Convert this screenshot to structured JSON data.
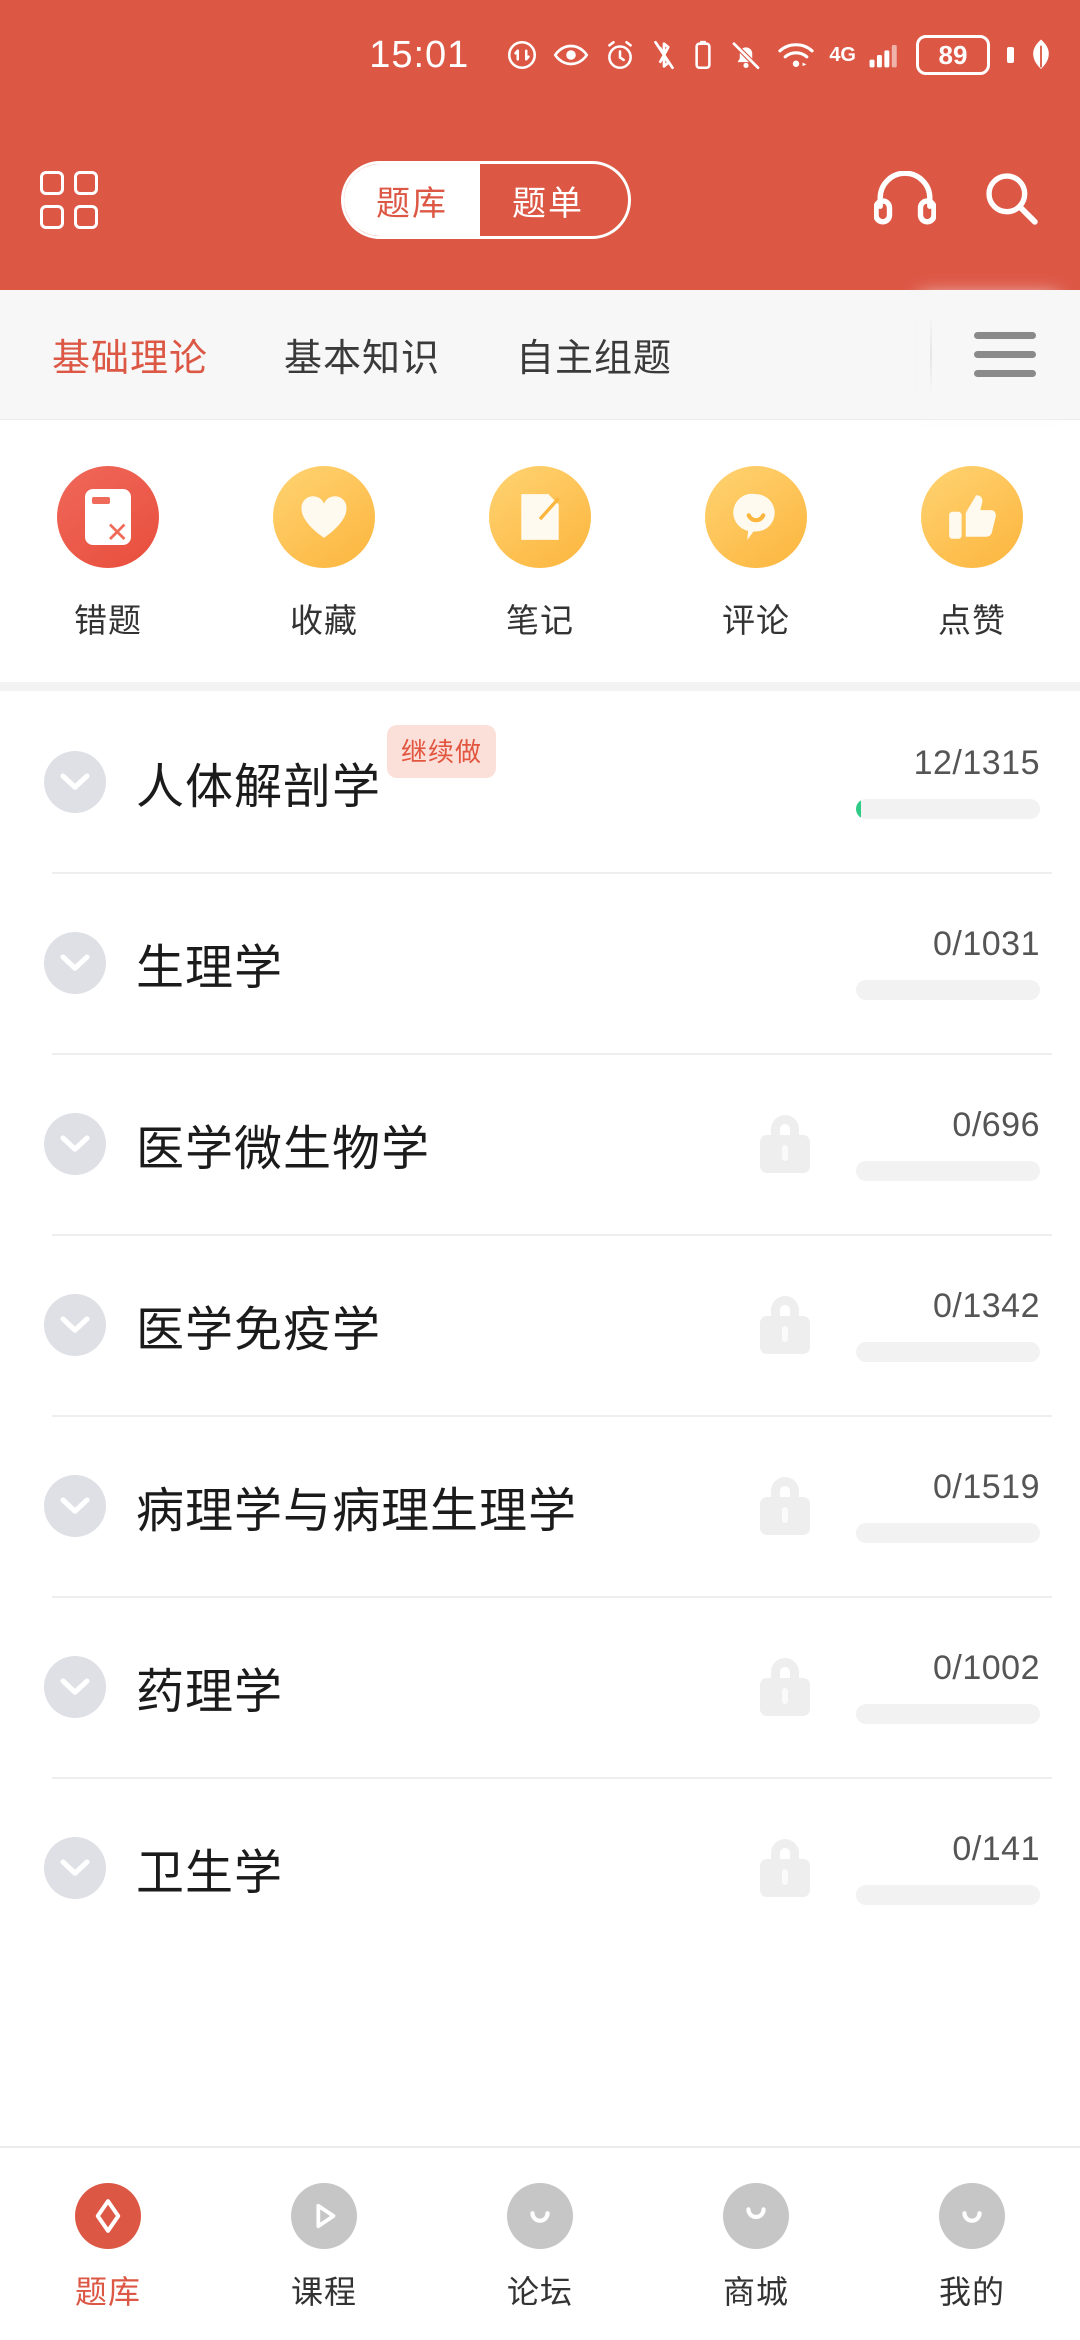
{
  "status_bar": {
    "time": "15:01",
    "battery_level": "89",
    "network": "4G",
    "icons": [
      "data-transfer-icon",
      "eye-care-icon",
      "alarm-clock-icon",
      "bluetooth-off-icon",
      "notification-mute-icon",
      "wifi-icon",
      "signal-icon",
      "battery-icon",
      "leaf-icon"
    ]
  },
  "header": {
    "grid_icon": "grid-menu-icon",
    "segment_left": "题库",
    "segment_right": "题单",
    "headphone_icon": "headphone-icon",
    "search_icon": "search-icon",
    "brand_color": "#dd5745"
  },
  "category_tabs": {
    "items": [
      {
        "label": "基础理论",
        "active": true
      },
      {
        "label": "基本知识",
        "active": false
      },
      {
        "label": "自主组题",
        "active": false
      }
    ],
    "menu_icon": "hamburger-menu-icon"
  },
  "quick_actions": [
    {
      "label": "错题",
      "icon": "wrong-question-card-icon",
      "color": "red"
    },
    {
      "label": "收藏",
      "icon": "heart-icon",
      "color": "yellow"
    },
    {
      "label": "笔记",
      "icon": "note-pencil-icon",
      "color": "yellow"
    },
    {
      "label": "评论",
      "icon": "comment-bubble-icon",
      "color": "yellow"
    },
    {
      "label": "点赞",
      "icon": "thumbs-up-icon",
      "color": "yellow"
    }
  ],
  "subjects": [
    {
      "title": "人体解剖学",
      "badge": "继续做",
      "locked": false,
      "done": 12,
      "total": 1315,
      "count_label": "12/1315",
      "percent": 0.9
    },
    {
      "title": "生理学",
      "badge": "",
      "locked": false,
      "done": 0,
      "total": 1031,
      "count_label": "0/1031",
      "percent": 0
    },
    {
      "title": "医学微生物学",
      "badge": "",
      "locked": true,
      "done": 0,
      "total": 696,
      "count_label": "0/696",
      "percent": 0
    },
    {
      "title": "医学免疫学",
      "badge": "",
      "locked": true,
      "done": 0,
      "total": 1342,
      "count_label": "0/1342",
      "percent": 0
    },
    {
      "title": "病理学与病理生理学",
      "badge": "",
      "locked": true,
      "done": 0,
      "total": 1519,
      "count_label": "0/1519",
      "percent": 0
    },
    {
      "title": "药理学",
      "badge": "",
      "locked": true,
      "done": 0,
      "total": 1002,
      "count_label": "0/1002",
      "percent": 0
    },
    {
      "title": "卫生学",
      "badge": "",
      "locked": true,
      "done": 0,
      "total": 141,
      "count_label": "0/141",
      "percent": 0
    }
  ],
  "bottom_nav": [
    {
      "label": "题库",
      "icon": "question-bank-icon",
      "active": true
    },
    {
      "label": "课程",
      "icon": "play-course-icon",
      "active": false
    },
    {
      "label": "论坛",
      "icon": "forum-chat-icon",
      "active": false
    },
    {
      "label": "商城",
      "icon": "shop-bag-icon",
      "active": false
    },
    {
      "label": "我的",
      "icon": "profile-person-icon",
      "active": false
    }
  ]
}
